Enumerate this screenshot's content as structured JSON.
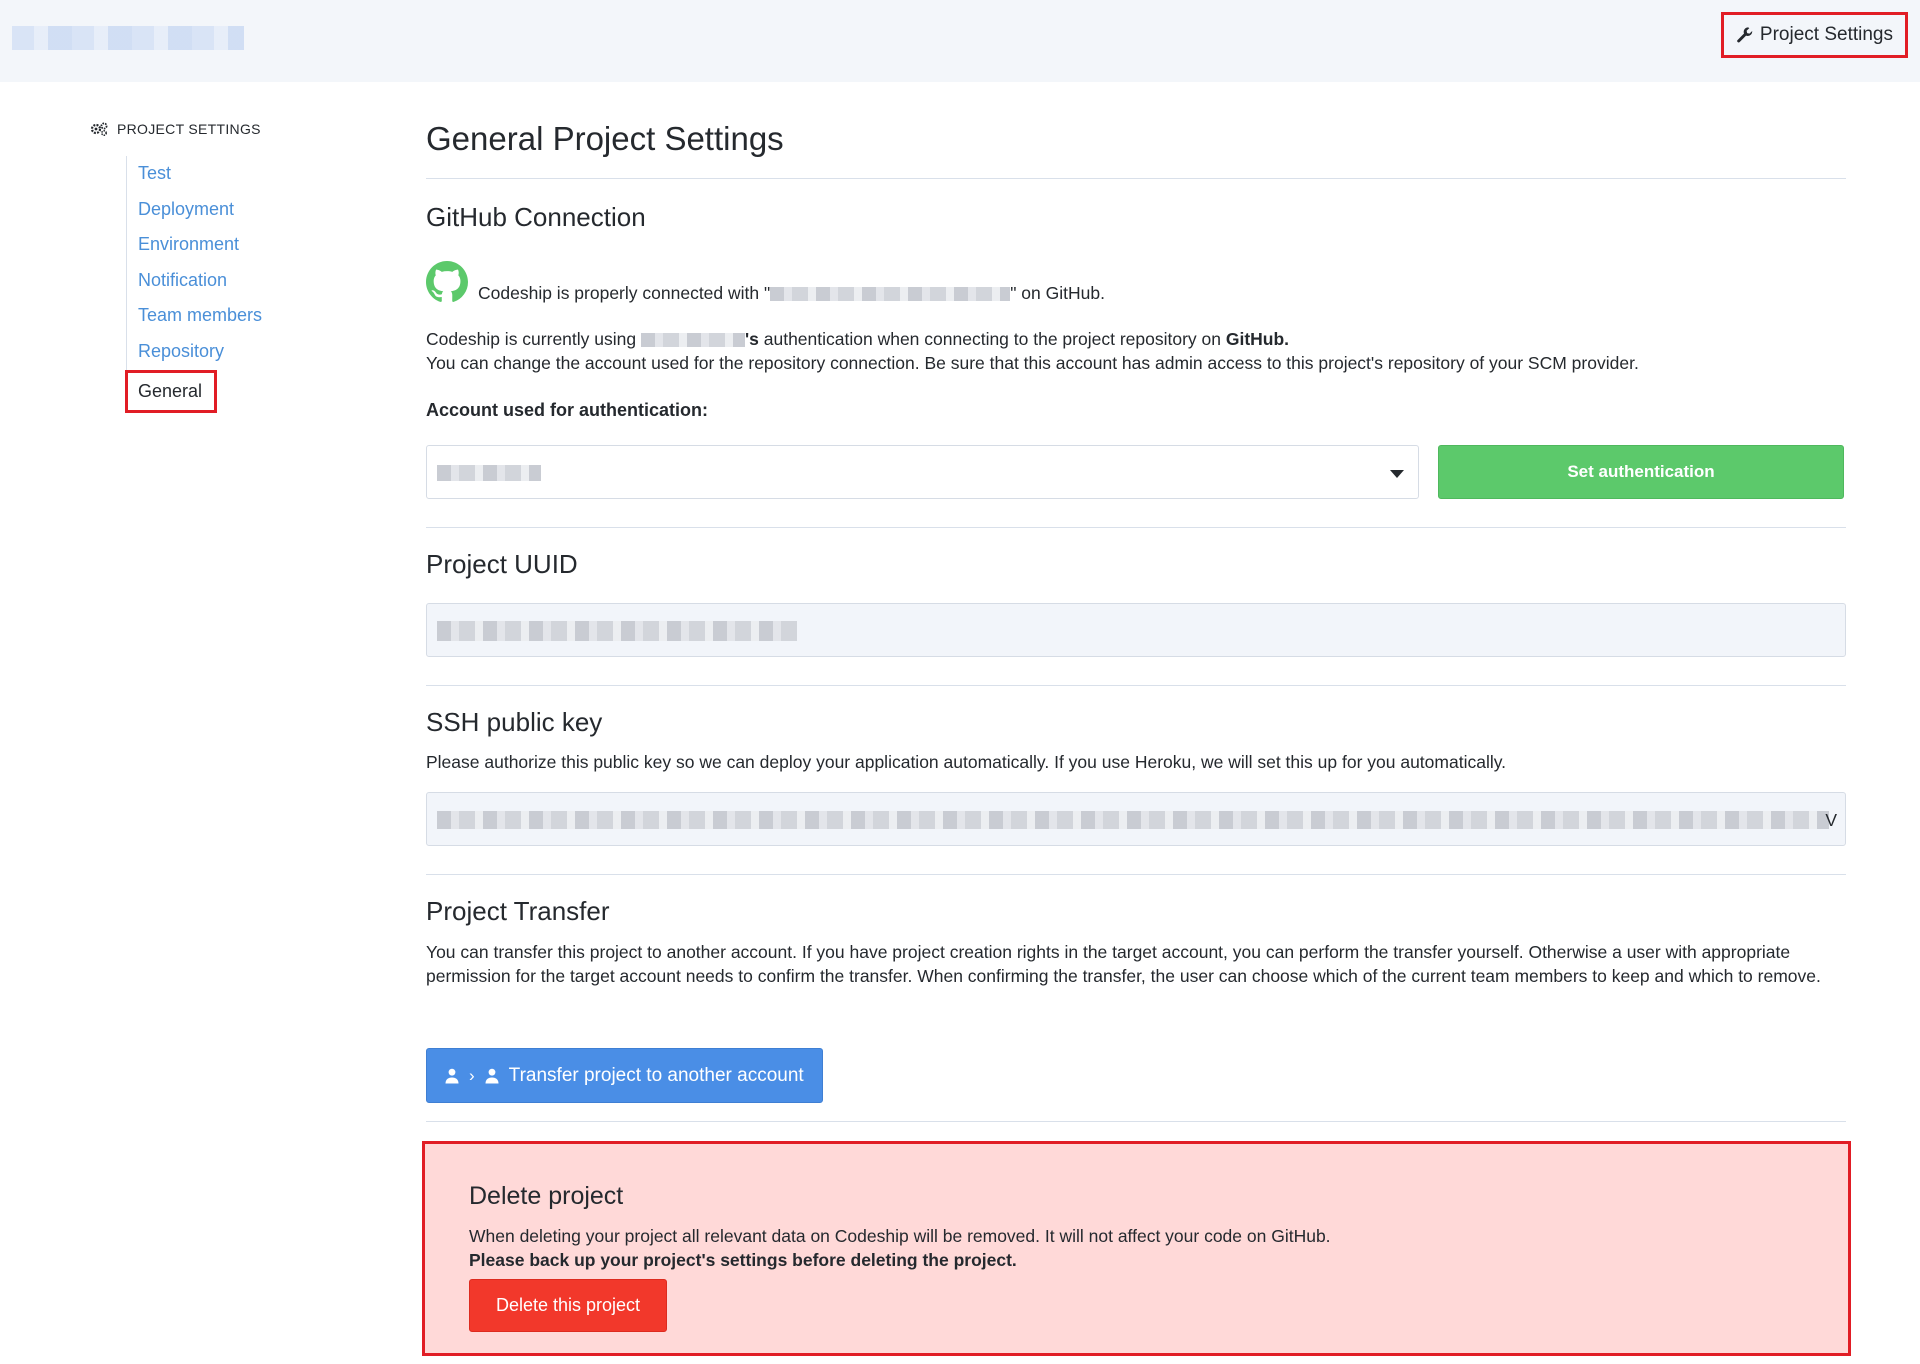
{
  "header": {
    "org_name_redacted": "",
    "project_settings_link": "Project Settings"
  },
  "sidebar": {
    "title": "PROJECT SETTINGS",
    "items": [
      {
        "label": "Test"
      },
      {
        "label": "Deployment"
      },
      {
        "label": "Environment"
      },
      {
        "label": "Notification"
      },
      {
        "label": "Team members"
      },
      {
        "label": "Repository"
      },
      {
        "label": "General",
        "active": true
      }
    ]
  },
  "main": {
    "page_title": "General Project Settings",
    "github": {
      "title": "GitHub Connection",
      "connected_prefix": "Codeship is properly connected with \"",
      "connected_suffix": "\" on GitHub.",
      "using_prefix": "Codeship is currently using ",
      "using_possessive": "'s",
      "using_middle": " authentication when connecting to the project repository on ",
      "using_provider": "GitHub.",
      "change_text": "You can change the account used for the repository connection. Be sure that this account has admin access to this project's repository of your SCM provider.",
      "account_label": "Account used for authentication:",
      "set_auth_button": "Set authentication"
    },
    "uuid": {
      "title": "Project UUID"
    },
    "ssh": {
      "title": "SSH public key",
      "description": "Please authorize this public key so we can deploy your application automatically. If you use Heroku, we will set this up for you automatically.",
      "key_tail": "V"
    },
    "transfer": {
      "title": "Project Transfer",
      "description": "You can transfer this project to another account. If you have project creation rights in the target account, you can perform the transfer yourself. Otherwise a user with appropriate permission for the target account needs to confirm the transfer. When confirming the transfer, the user can choose which of the current team members to keep and which to remove.",
      "button": "Transfer project to another account"
    },
    "delete": {
      "title": "Delete project",
      "description": "When deleting your project all relevant data on Codeship will be removed. It will not affect your code on GitHub.",
      "warning": "Please back up your project's settings before deleting the project.",
      "button": "Delete this project"
    }
  },
  "colors": {
    "accent_blue": "#4a8ee6",
    "link_blue": "#4a8fd8",
    "green": "#5cc96b",
    "danger_red": "#f2382b",
    "danger_bg": "#ffd9d8",
    "highlight_red": "#e11d25",
    "github_icon": "#5cc96b"
  },
  "icons": {
    "header": "wrench-icon",
    "sidebar": "gears-icon",
    "github": "github-icon",
    "transfer": "user-icon"
  }
}
